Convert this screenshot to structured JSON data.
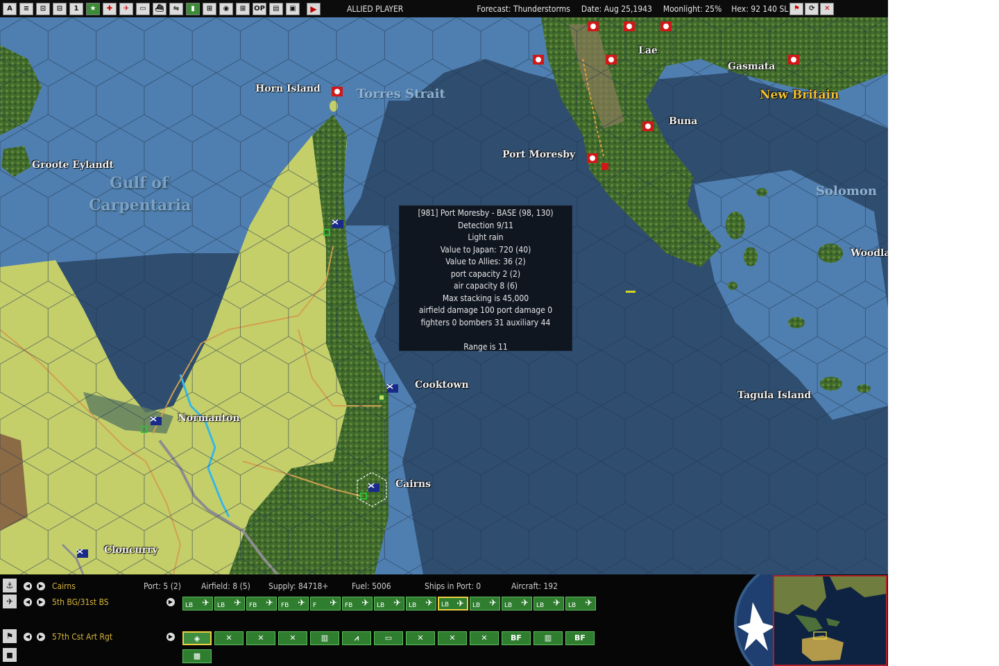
{
  "topbar": {
    "player": "ALLIED PLAYER",
    "forecast": "Forecast: Thunderstorms",
    "date": "Date: Aug 25,1943",
    "moonlight": "Moonlight: 25%",
    "hex": "Hex: 92 140 SL",
    "icons": [
      "A",
      "≡",
      "⊡",
      "⊟",
      "1",
      "★",
      "✚",
      "✈",
      "▭",
      "⛴",
      "⇋",
      "▮",
      "⊞",
      "◉",
      "⊞",
      "OP",
      "▤",
      "▣"
    ]
  },
  "map": {
    "labels": [
      {
        "text": "Horn Island",
        "kind": "town"
      },
      {
        "text": "Torres Strait",
        "kind": "ghost"
      },
      {
        "text": "Groote Eylandt",
        "kind": "town"
      },
      {
        "text": "Gulf of",
        "kind": "big"
      },
      {
        "text": "Carpentaria",
        "kind": "big"
      },
      {
        "text": "Port Moresby",
        "kind": "town"
      },
      {
        "text": "Lae",
        "kind": "town"
      },
      {
        "text": "Gasmata",
        "kind": "town"
      },
      {
        "text": "New Britain",
        "kind": "gold"
      },
      {
        "text": "Buna",
        "kind": "town"
      },
      {
        "text": "Solomon",
        "kind": "ghost"
      },
      {
        "text": "Woodla",
        "kind": "town"
      },
      {
        "text": "Cooktown",
        "kind": "town"
      },
      {
        "text": "Normanton",
        "kind": "town"
      },
      {
        "text": "Cairns",
        "kind": "town"
      },
      {
        "text": "Tagula Island",
        "kind": "town"
      },
      {
        "text": "Cloncurry",
        "kind": "town"
      }
    ],
    "tooltip": [
      "[981] Port Moresby  - BASE (98, 130)",
      "Detection 9/11",
      "Light rain",
      "Value to Japan: 720 (40)",
      "Value to Allies: 36 (2)",
      "port capacity 2 (2)",
      "air capacity 8 (6)",
      "Max stacking is 45,000",
      "airfield damage 100  port damage 0",
      "fighters 0  bombers 31  auxiliary 44",
      "",
      "Range is 11"
    ]
  },
  "base_panel": {
    "name": "Cairns",
    "port": "Port: 5 (2)",
    "airfield": "Airfield: 8 (5)",
    "supply": "Supply: 84718+",
    "fuel": "Fuel: 5006",
    "ships": "Ships in Port: 0",
    "aircraft": "Aircraft: 192",
    "air_unit": "5th BG/31st BS",
    "air_groups": [
      "LB",
      "LB",
      "FB",
      "FB",
      "F",
      "FB",
      "LB",
      "LB",
      "LB",
      "LB",
      "LB",
      "LB",
      "LB"
    ],
    "land_unit": "57th Cst Art Rgt",
    "land_units": [
      "◈",
      "✕",
      "✕",
      "✕",
      "▥",
      "⩘",
      "▭",
      "✕",
      "✕",
      "✕",
      "BF",
      "▥",
      "BF"
    ]
  },
  "colors": {
    "deep_sea": "#2f4d6f",
    "shallow_sea": "#4f7fb0",
    "clear_land": "#c5cf6a",
    "jungle": "#3f6a2a",
    "japan_red": "#d01818",
    "allied_green": "#2f7d2f"
  }
}
